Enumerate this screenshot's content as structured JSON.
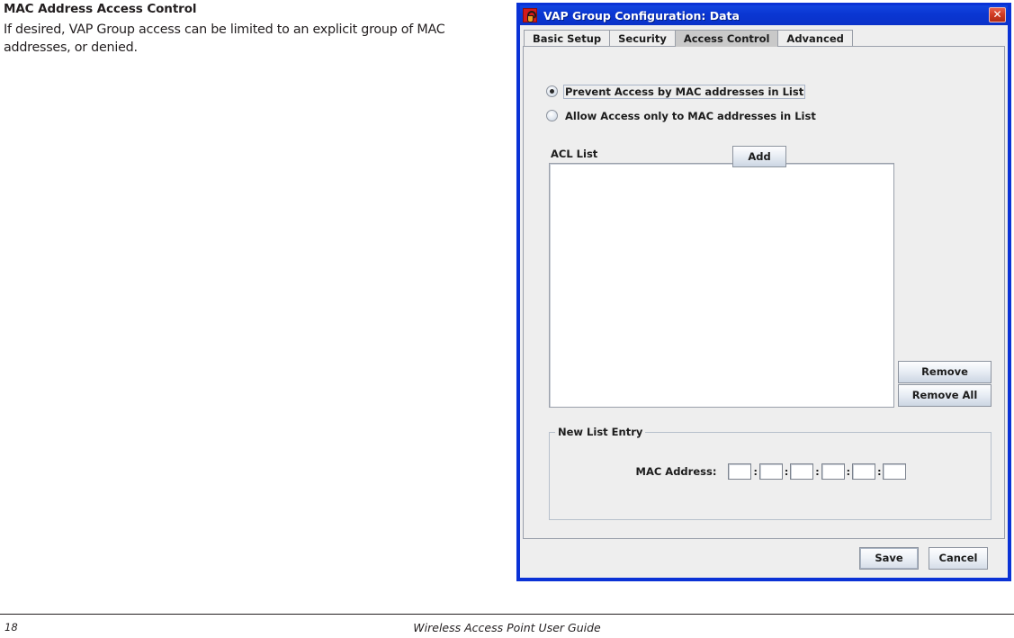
{
  "document": {
    "heading": "MAC Address Access Control",
    "body": "If desired, VAP Group access can be limited to an explicit group of MAC addresses, or denied.",
    "footer": {
      "page_number": "18",
      "guide_title": "Wireless Access Point User Guide"
    }
  },
  "dialog": {
    "title": "VAP Group Configuration: Data",
    "app_icon": "java-coffee-cup-icon",
    "close_label": "✕",
    "titlebar_color": "#0a32c9",
    "tabs": [
      {
        "label": "Basic Setup",
        "selected": false
      },
      {
        "label": "Security",
        "selected": false
      },
      {
        "label": "Access Control",
        "selected": true
      },
      {
        "label": "Advanced",
        "selected": false
      }
    ],
    "access_control": {
      "radio_options": [
        {
          "label": "Prevent Access by MAC addresses in List",
          "checked": true,
          "focused": true
        },
        {
          "label": "Allow Access only to MAC addresses in List",
          "checked": false,
          "focused": false
        }
      ],
      "acl_list": {
        "label": "ACL List",
        "items": []
      },
      "list_buttons": [
        {
          "label": "Remove"
        },
        {
          "label": "Remove All"
        }
      ],
      "new_list_entry": {
        "legend": "New List Entry",
        "mac_label": "MAC Address:",
        "separator": ":",
        "octets": [
          "",
          "",
          "",
          "",
          "",
          ""
        ],
        "add_label": "Add"
      }
    },
    "footer_buttons": [
      {
        "label": "Save",
        "focused": true
      },
      {
        "label": "Cancel",
        "focused": false
      }
    ]
  }
}
